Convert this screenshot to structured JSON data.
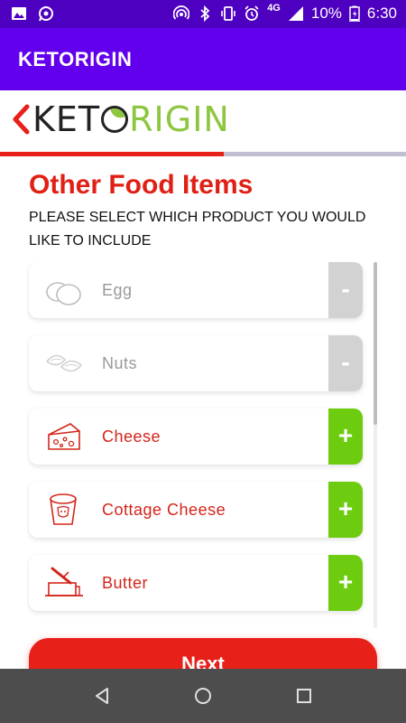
{
  "status_bar": {
    "network": "4G",
    "battery": "10%",
    "time": "6:30",
    "icons": [
      "image-icon",
      "whatsapp-icon",
      "hotspot-icon",
      "bluetooth-icon",
      "vibrate-icon",
      "alarm-icon",
      "signal-icon",
      "battery-charging-icon"
    ]
  },
  "app_bar": {
    "title": "KETORIGIN"
  },
  "logo": {
    "part1": "KET",
    "part2": "RIGIN"
  },
  "progress": {
    "fraction": 0.55
  },
  "page": {
    "heading": "Other Food Items",
    "subheading": "PLEASE SELECT WHICH PRODUCT YOU WOULD LIKE TO INCLUDE"
  },
  "items": [
    {
      "label": "Egg",
      "state": "disabled",
      "action": "-",
      "icon": "egg-icon"
    },
    {
      "label": "Nuts",
      "state": "disabled",
      "action": "-",
      "icon": "nuts-icon"
    },
    {
      "label": "Cheese",
      "state": "active",
      "action": "+",
      "icon": "cheese-icon"
    },
    {
      "label": "Cottage Cheese",
      "state": "active",
      "action": "+",
      "icon": "cottage-cheese-icon"
    },
    {
      "label": "Butter",
      "state": "active",
      "action": "+",
      "icon": "butter-icon"
    }
  ],
  "next_button": {
    "label": "Next"
  },
  "colors": {
    "status_bar": "#4e00c0",
    "app_bar": "#6200ee",
    "accent_red": "#e8201a",
    "add_green": "#6dcc10",
    "disabled_gray": "#d2d2d2",
    "logo_green": "#8dc63f"
  }
}
